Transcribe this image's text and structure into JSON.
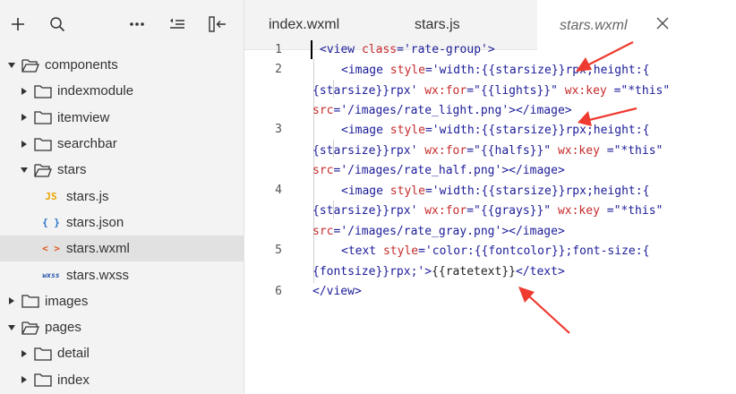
{
  "sidebar": {
    "tree": [
      {
        "label": "components",
        "type": "folder",
        "open": true,
        "indent": 0
      },
      {
        "label": "indexmodule",
        "type": "folder",
        "open": false,
        "indent": 1
      },
      {
        "label": "itemview",
        "type": "folder",
        "open": false,
        "indent": 1
      },
      {
        "label": "searchbar",
        "type": "folder",
        "open": false,
        "indent": 1
      },
      {
        "label": "stars",
        "type": "folder",
        "open": true,
        "indent": 1
      },
      {
        "label": "stars.js",
        "type": "js",
        "icon": "JS",
        "indent": 2
      },
      {
        "label": "stars.json",
        "type": "json",
        "icon": "{ }",
        "indent": 2
      },
      {
        "label": "stars.wxml",
        "type": "wxml",
        "icon": "< >",
        "indent": 2,
        "selected": true
      },
      {
        "label": "stars.wxss",
        "type": "wxss",
        "icon": "wxss",
        "indent": 2
      },
      {
        "label": "images",
        "type": "folder",
        "open": false,
        "indent": 0
      },
      {
        "label": "pages",
        "type": "folder",
        "open": true,
        "indent": 0
      },
      {
        "label": "detail",
        "type": "folder",
        "open": false,
        "indent": 1
      },
      {
        "label": "index",
        "type": "folder",
        "open": false,
        "indent": 1
      }
    ]
  },
  "tabs": [
    {
      "label": "index.wxml",
      "active": false
    },
    {
      "label": "stars.js",
      "active": false
    },
    {
      "label": "stars.wxml",
      "active": true
    }
  ],
  "editor": {
    "line_numbers": [
      "1",
      "2",
      "3",
      "4",
      "5",
      "6"
    ]
  },
  "colors": {
    "tag": "#1c1c99",
    "attr": "#c62b2b",
    "arrow": "#ee3a30",
    "js": "#e8a400",
    "json": "#2b73c8",
    "wxml": "#e0561b",
    "wxss": "#1f4fa8"
  }
}
